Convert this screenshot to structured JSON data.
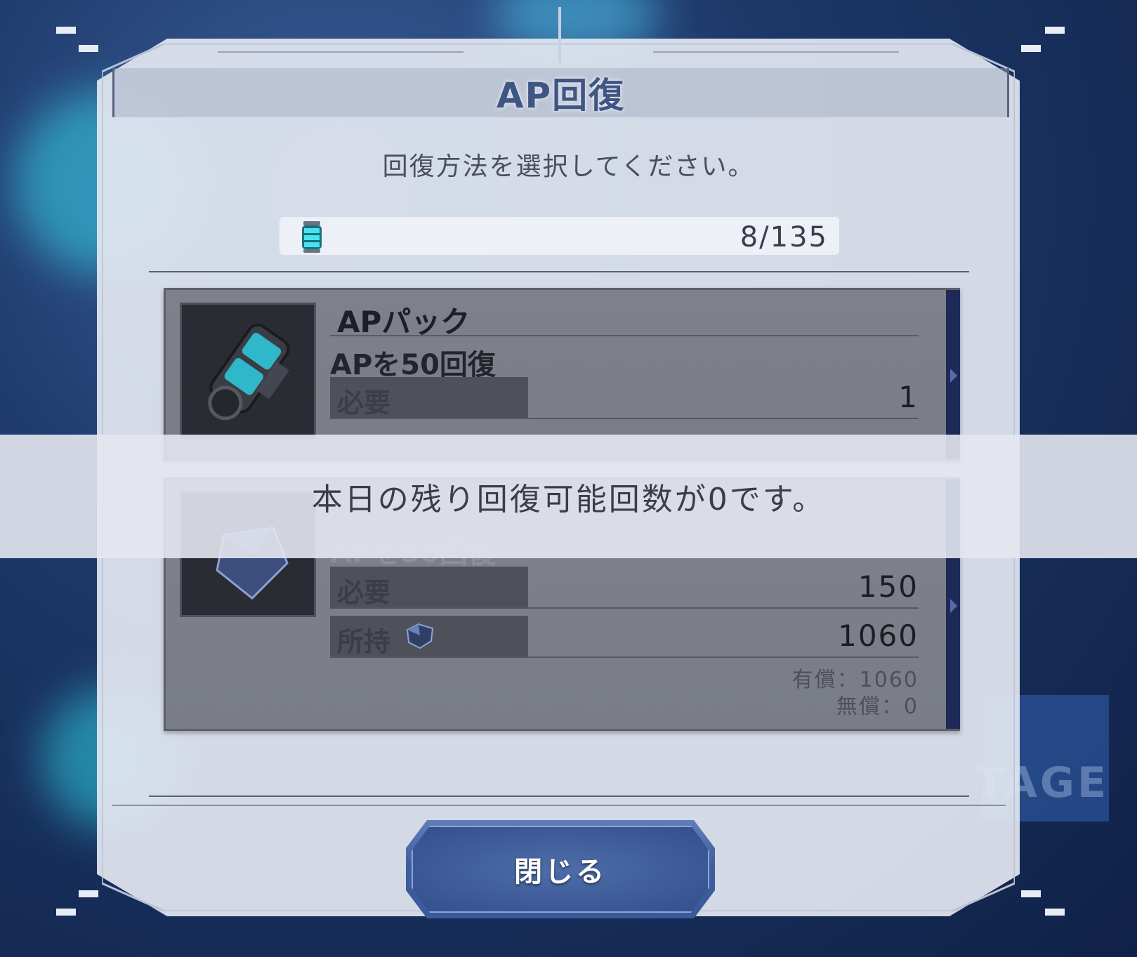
{
  "dialog": {
    "title": "AP回復",
    "subtitle": "回復方法を選択してください。",
    "ap_counter": "8/135",
    "ap_icon": "ap-canister-icon",
    "close_label": "閉じる"
  },
  "options": [
    {
      "name": "APパック",
      "description": "APを50回復",
      "required_label": "必要",
      "required_value": "1",
      "icon": "ap-pack-icon"
    },
    {
      "description": "APを50回復",
      "required_label": "必要",
      "required_value": "150",
      "owned_label": "所持",
      "owned_value": "1060",
      "paid_text": "有償：1060",
      "free_text": "無償：0",
      "icon": "gem-icon"
    }
  ],
  "toast": {
    "message": "本日の残り回復可能回数が0です。"
  },
  "colors": {
    "title": "#3f5685",
    "card": "#7e818b",
    "button": "#3c5c9c"
  }
}
